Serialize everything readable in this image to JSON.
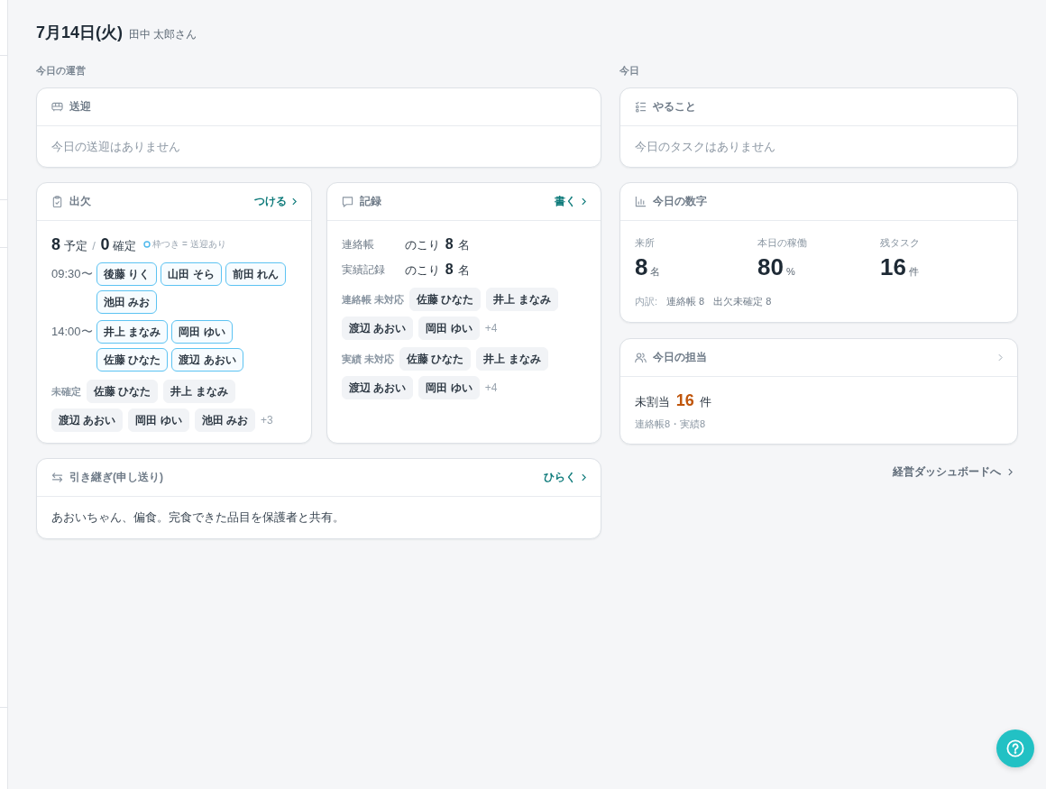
{
  "header": {
    "date": "7月14日(火)",
    "user": "田中 太郎さん"
  },
  "operations": {
    "label": "今日の運営",
    "pickup": {
      "title": "送迎",
      "empty_message": "今日の送迎はありません"
    },
    "attendance": {
      "title": "出欠",
      "action": "つける",
      "planned": "8",
      "planned_label": "予定",
      "divider": "/",
      "confirmed": "0",
      "confirmed_label": "確定",
      "legend": "枠つき = 送迎あり",
      "slots": [
        {
          "time": "09:30〜",
          "children": [
            {
              "name": "後藤 りく",
              "pickup": true
            },
            {
              "name": "山田 そら",
              "pickup": true
            },
            {
              "name": "前田 れん",
              "pickup": true
            },
            {
              "name": "池田 みお",
              "pickup": true
            }
          ]
        },
        {
          "time": "14:00〜",
          "children": [
            {
              "name": "井上 まなみ",
              "pickup": true
            },
            {
              "name": "岡田 ゆい",
              "pickup": true
            },
            {
              "name": "佐藤 ひなた",
              "pickup": true
            },
            {
              "name": "渡辺 あおい",
              "pickup": true
            }
          ]
        }
      ],
      "unconfirmed": {
        "label": "未確定",
        "children": [
          "佐藤 ひなた",
          "井上 まなみ",
          "渡辺 あおい",
          "岡田 ゆい",
          "池田 みお"
        ],
        "more": "+3"
      }
    },
    "records": {
      "title": "記録",
      "action": "書く",
      "remaining": [
        {
          "label": "連絡帳",
          "prefix": "のこり",
          "count": "8",
          "unit": "名"
        },
        {
          "label": "実績記録",
          "prefix": "のこり",
          "count": "8",
          "unit": "名"
        }
      ],
      "pending": [
        {
          "label": "連絡帳 未対応",
          "children": [
            "佐藤 ひなた",
            "井上 まなみ",
            "渡辺 あおい",
            "岡田 ゆい"
          ],
          "more": "+4"
        },
        {
          "label": "実績 未対応",
          "children": [
            "佐藤 ひなた",
            "井上 まなみ",
            "渡辺 あおい",
            "岡田 ゆい"
          ],
          "more": "+4"
        }
      ]
    },
    "handover": {
      "title": "引き継ぎ(申し送り)",
      "action": "ひらく",
      "note": "あおいちゃん、偏食。完食できた品目を保護者と共有。"
    }
  },
  "today": {
    "label": "今日",
    "tasks": {
      "title": "やること",
      "empty_message": "今日のタスクはありません"
    },
    "numbers": {
      "title": "今日の数字",
      "stats": [
        {
          "label": "来所",
          "value": "8",
          "unit": "名"
        },
        {
          "label": "本日の稼働",
          "value": "80",
          "unit": "%"
        },
        {
          "label": "残タスク",
          "value": "16",
          "unit": "件"
        }
      ],
      "breakdown_label": "内訳:",
      "breakdown": [
        "連絡帳 8",
        "出欠未確定 8"
      ]
    },
    "staff": {
      "title": "今日の担当",
      "unassigned_label": "未割当",
      "unassigned_count": "16",
      "unassigned_unit": "件",
      "detail": "連絡帳8・実績8"
    },
    "dashboard_link": "経営ダッシュボードへ"
  }
}
